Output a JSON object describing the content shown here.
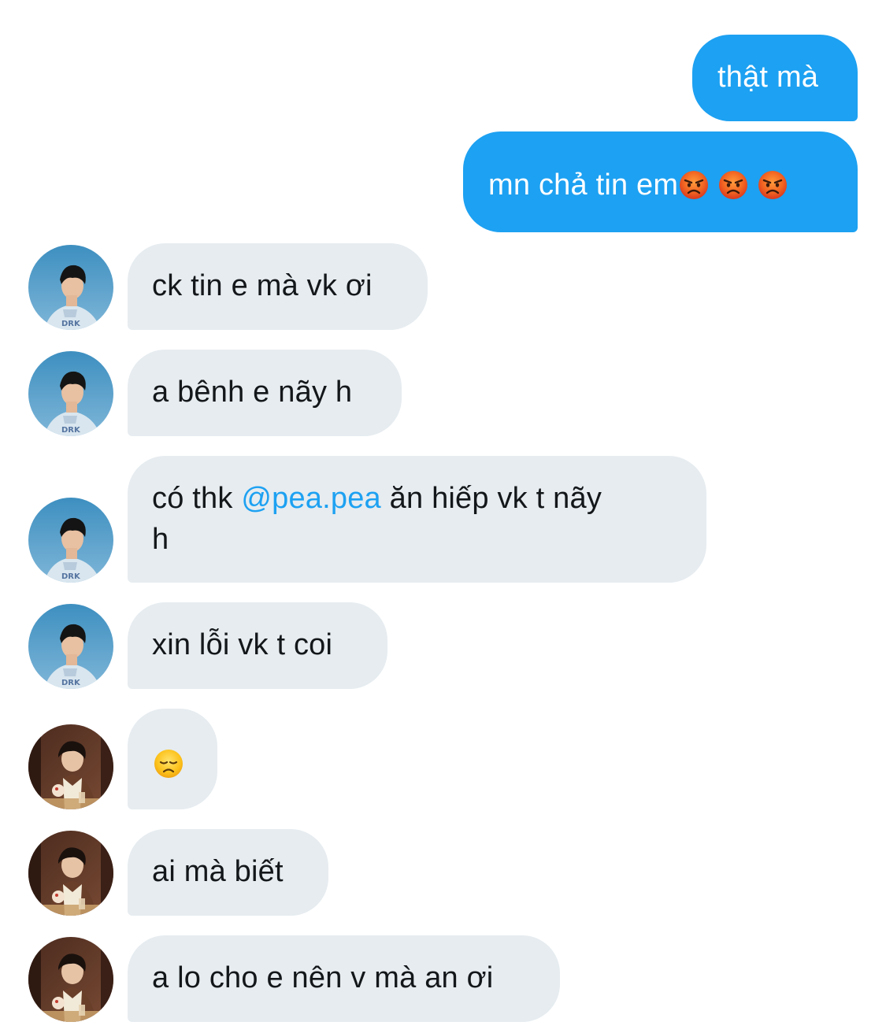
{
  "messages": {
    "m1": {
      "text": "thật mà"
    },
    "m2": {
      "text": "mn chả tin em",
      "emojis": [
        "angry-face",
        "angry-face",
        "angry-face"
      ]
    },
    "m3": {
      "text": "ck tin e mà vk ơi"
    },
    "m4": {
      "text": "a bênh e nãy h"
    },
    "m5": {
      "before": "có thk ",
      "mention": "@pea.pea",
      "after": " ăn hiếp vk t nãy",
      "line2": "h"
    },
    "m6": {
      "text": "xin lỗi vk t coi"
    },
    "m7": {
      "emoji": "disappointed-face"
    },
    "m8": {
      "text": "ai mà biết"
    },
    "m9": {
      "text": "a lo cho e nên v mà an ơi"
    }
  },
  "colors": {
    "outgoing_bubble": "#1da1f2",
    "incoming_bubble": "#e6ecf0",
    "mention": "#1da1f2",
    "incoming_text": "#14171a"
  }
}
